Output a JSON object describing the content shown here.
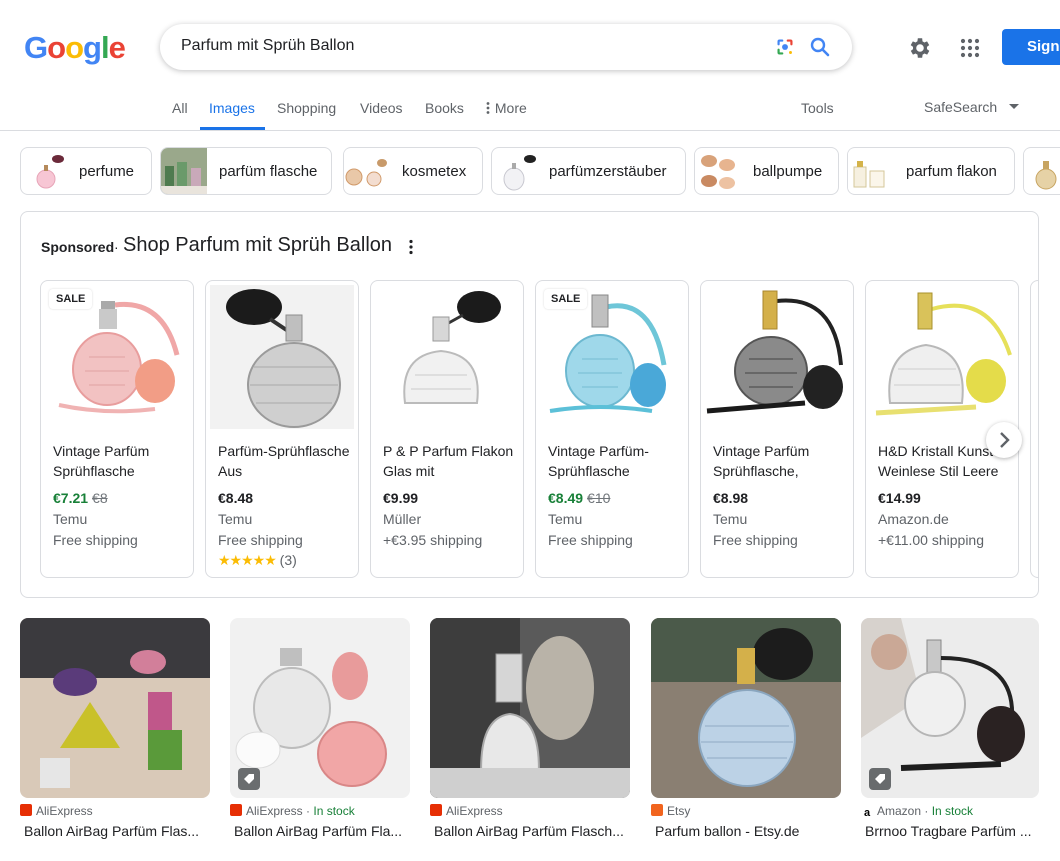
{
  "logo": [
    "G",
    "o",
    "o",
    "g",
    "l",
    "e"
  ],
  "colors": {
    "blue": "#4285f4",
    "red": "#ea4335",
    "yellow": "#fbbc05",
    "green": "#34a853",
    "accent": "#1a73e8",
    "price_deal": "#188038"
  },
  "search": {
    "query": "Parfum mit Sprüh Ballon"
  },
  "header": {
    "signin_label": "Sign"
  },
  "nav": {
    "all": "All",
    "images": "Images",
    "shopping": "Shopping",
    "videos": "Videos",
    "books": "Books",
    "more": "More",
    "tools": "Tools",
    "safesearch": "SafeSearch"
  },
  "chips": [
    "perfume",
    "parfüm flasche",
    "kosmetex",
    "parfümzerstäuber",
    "ballpumpe",
    "parfum flakon"
  ],
  "sponsored": {
    "label": "Sponsored",
    "separator": "·",
    "title": "Shop Parfum mit Sprüh Ballon",
    "cards": [
      {
        "sale": "SALE",
        "title": "Vintage Parfüm Sprühflasche",
        "price": "€7.21",
        "old_price": "€8",
        "merchant": "Temu",
        "shipping": "Free shipping"
      },
      {
        "sale": "",
        "title": "Parfüm-Sprühflasche Aus",
        "price": "€8.48",
        "old_price": "",
        "merchant": "Temu",
        "shipping": "Free shipping",
        "stars": "★★★★★",
        "rating_count": "(3)"
      },
      {
        "sale": "",
        "title": "P & P Parfum Flakon Glas mit",
        "price": "€9.99",
        "old_price": "",
        "merchant": "Müller",
        "shipping": "+€3.95 shipping"
      },
      {
        "sale": "SALE",
        "title": "Vintage Parfüm-Sprühflasche",
        "price": "€8.49",
        "old_price": "€10",
        "merchant": "Temu",
        "shipping": "Free shipping"
      },
      {
        "sale": "",
        "title": "Vintage Parfüm Sprühflasche,",
        "price": "€8.98",
        "old_price": "",
        "merchant": "Temu",
        "shipping": "Free shipping"
      },
      {
        "sale": "",
        "title": "H&D Kristall Kunst Weinlese Stil Leere",
        "price": "€14.99",
        "old_price": "",
        "merchant": "Amazon.de",
        "shipping": "+€11.00 shipping"
      }
    ]
  },
  "results": [
    {
      "source": "AliExpress",
      "stock": "",
      "title": "Ballon AirBag Parfüm Flas..."
    },
    {
      "source": "AliExpress",
      "stock": "In stock",
      "title": "Ballon AirBag Parfüm Fla..."
    },
    {
      "source": "AliExpress",
      "stock": "",
      "title": "Ballon AirBag Parfüm Flasch..."
    },
    {
      "source": "Etsy",
      "stock": "",
      "title": "Parfum ballon - Etsy.de"
    },
    {
      "source": "Amazon",
      "stock": "In stock",
      "title": "Brrnoo Tragbare Parfüm ..."
    }
  ]
}
